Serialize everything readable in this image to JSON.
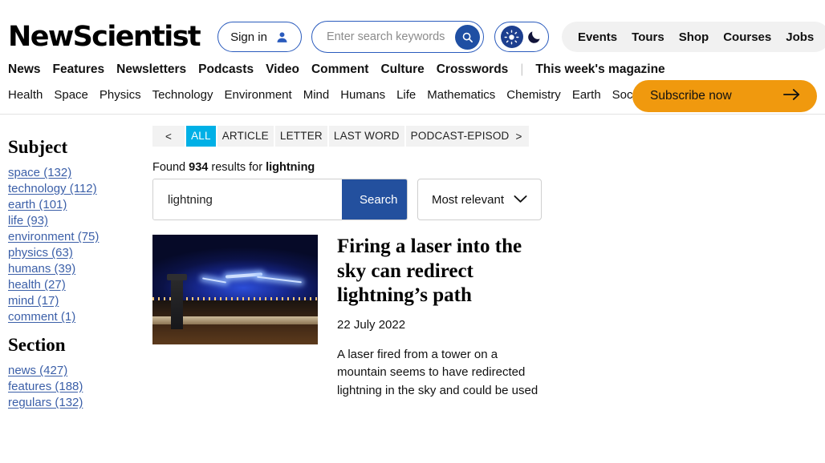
{
  "header": {
    "logo": "NewScientist",
    "signin_label": "Sign in",
    "search_placeholder": "Enter search keywords",
    "search_value": "",
    "util_nav": [
      {
        "label": "Events"
      },
      {
        "label": "Tours"
      },
      {
        "label": "Shop"
      },
      {
        "label": "Courses"
      },
      {
        "label": "Jobs"
      }
    ],
    "subscribe_label": "Subscribe now",
    "theme": {
      "light_icon": "sun-icon",
      "dark_icon": "moon-icon",
      "active": "light"
    },
    "colors": {
      "accent_blue": "#1f4fa3",
      "magazine_red": "#c8102e",
      "subscribe_orange": "#f0990e"
    }
  },
  "nav": {
    "primary": [
      {
        "label": "News"
      },
      {
        "label": "Features"
      },
      {
        "label": "Newsletters"
      },
      {
        "label": "Podcasts"
      },
      {
        "label": "Video"
      },
      {
        "label": "Comment"
      },
      {
        "label": "Culture"
      },
      {
        "label": "Crosswords"
      }
    ],
    "separator": "|",
    "magazine_link": "This week's magazine",
    "secondary": [
      {
        "label": "Health"
      },
      {
        "label": "Space"
      },
      {
        "label": "Physics"
      },
      {
        "label": "Technology"
      },
      {
        "label": "Environment"
      },
      {
        "label": "Mind"
      },
      {
        "label": "Humans"
      },
      {
        "label": "Life"
      },
      {
        "label": "Mathematics"
      },
      {
        "label": "Chemistry"
      },
      {
        "label": "Earth"
      },
      {
        "label": "Society"
      }
    ]
  },
  "sidebar": {
    "subject": {
      "title": "Subject",
      "items": [
        {
          "label": "space (132)"
        },
        {
          "label": "technology (112)"
        },
        {
          "label": "earth (101)"
        },
        {
          "label": "life (93)"
        },
        {
          "label": "environment (75)"
        },
        {
          "label": "physics (63)"
        },
        {
          "label": "humans (39)"
        },
        {
          "label": "health (27)"
        },
        {
          "label": "mind (17)"
        },
        {
          "label": "comment (1)"
        }
      ]
    },
    "section": {
      "title": "Section",
      "items": [
        {
          "label": "news (427)"
        },
        {
          "label": "features (188)"
        },
        {
          "label": "regulars (132)"
        }
      ]
    }
  },
  "results": {
    "type_filter": {
      "prev": "<",
      "next": ">",
      "tabs": [
        {
          "label": "ALL",
          "active": true
        },
        {
          "label": "ARTICLE",
          "active": false
        },
        {
          "label": "LETTER",
          "active": false
        },
        {
          "label": "LAST WORD",
          "active": false
        },
        {
          "label": "PODCAST-EPISOD",
          "active": false
        }
      ],
      "active_color": "#00b0e6"
    },
    "found_prefix": "Found ",
    "found_count": "934",
    "found_middle": " results for ",
    "found_query": "lightning",
    "search_value": "lightning",
    "search_button": "Search",
    "sort_value": "Most relevant",
    "items": [
      {
        "title": "Firing a laser into the sky can redirect lightning’s path",
        "date": "22 July 2022",
        "excerpt": "A laser fired from a tower on a mountain seems to have redirected lightning in the sky and could be used",
        "thumbnail": "lightning-storm-over-city-photo"
      }
    ]
  }
}
